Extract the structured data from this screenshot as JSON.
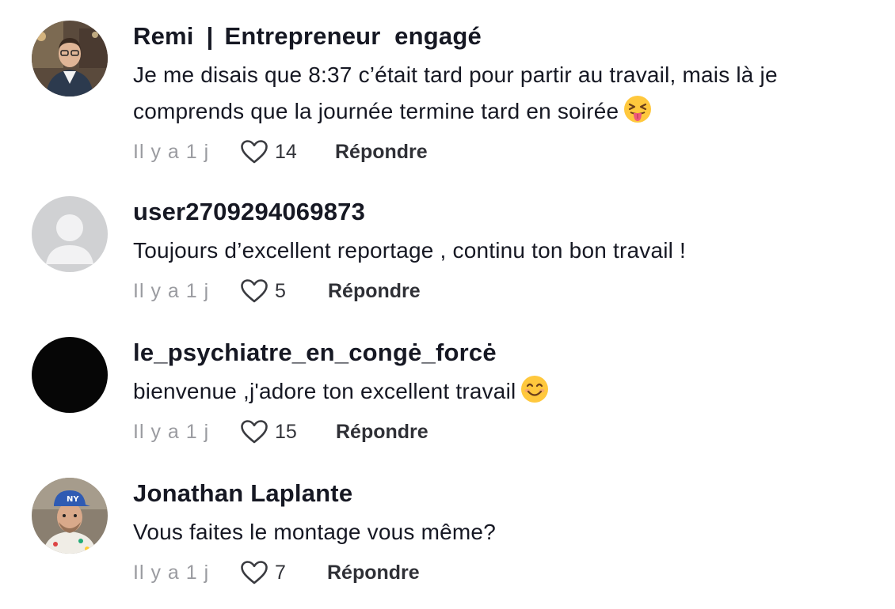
{
  "comments": [
    {
      "username": "Remi",
      "separator": "|",
      "title": "Entrepreneur  engagé",
      "text": "Je me disais que 8:37 c’était tard pour partir au travail, mais là je comprends que la journée termine tard en soirée",
      "emoji": "squinting-tongue-face-emoji",
      "time": "Il y a 1 j",
      "likes": "14",
      "reply_label": "Répondre",
      "avatar": "man-in-suit-photo"
    },
    {
      "username": "user2709294069873",
      "text": "Toujours d’excellent reportage , continu ton bon travail !",
      "time": "Il y a 1 j",
      "likes": "5",
      "reply_label": "Répondre",
      "avatar": "default-user-avatar"
    },
    {
      "username": "le_psychiatre_en_congė_forcė",
      "text": "bienvenue ,j'adore ton excellent travail",
      "emoji": "smiling-face-emoji",
      "time": "Il y a 1 j",
      "likes": "15",
      "reply_label": "Répondre",
      "avatar": "black-avatar"
    },
    {
      "username": "Jonathan Laplante",
      "text": "Vous faites le montage vous même?",
      "time": "Il y a 1 j",
      "likes": "7",
      "reply_label": "Répondre",
      "avatar": "man-in-cap-photo"
    }
  ],
  "colors": {
    "text": "#161823",
    "meta": "#9a9ba0",
    "reply": "#2f3036",
    "emoji_face": "#ffc83d"
  }
}
